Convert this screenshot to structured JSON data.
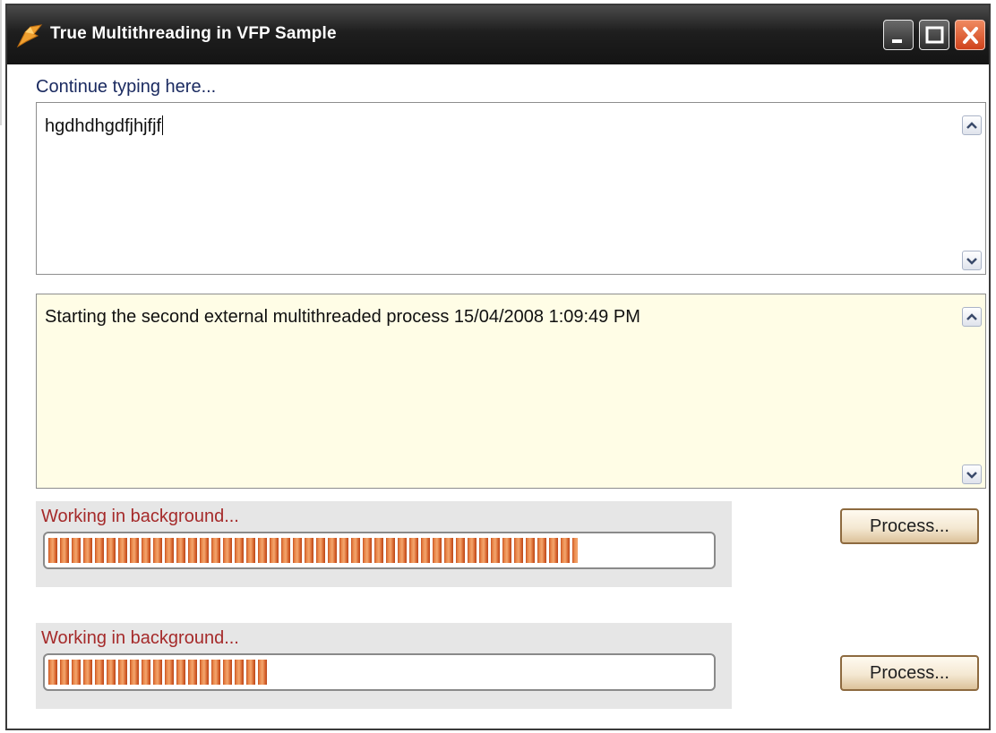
{
  "window": {
    "title": "True Multithreading in VFP Sample",
    "title_bar_color": "#1e1e1e",
    "icons": [
      "app-icon",
      "minimize-icon",
      "maximize-icon",
      "close-icon"
    ]
  },
  "input_area": {
    "label": "Continue typing here...",
    "value": "hgdhdhgdfjhjfjf"
  },
  "log_area": {
    "value": "Starting the second external multithreaded process 15/04/2008 1:09:49 PM",
    "background": "#fffde6"
  },
  "processes": [
    {
      "status": "Working in background...",
      "progress": 0.8,
      "button_label": "Process..."
    },
    {
      "status": "Working in background...",
      "progress": 0.33,
      "button_label": "Process..."
    }
  ],
  "colors": {
    "status_text": "#a52a2a",
    "label_text": "#1a2a60",
    "progress_fill": "#d8652e"
  }
}
